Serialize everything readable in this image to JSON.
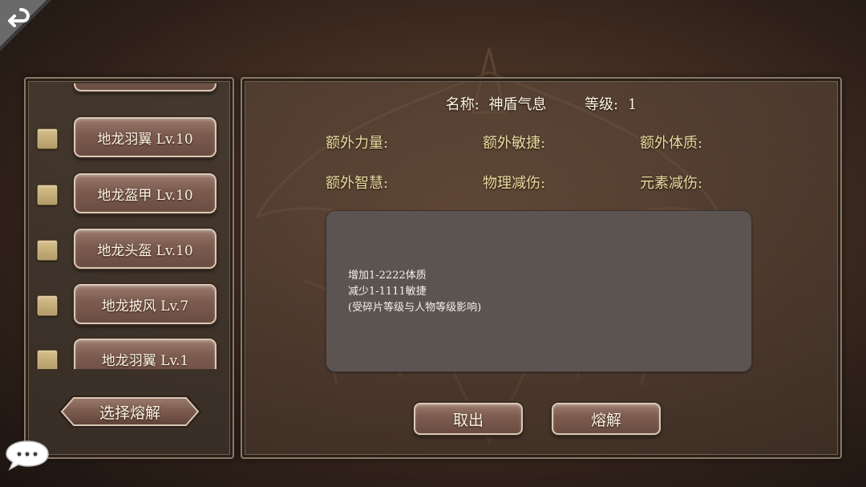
{
  "left_list": {
    "items": [
      {
        "label": ""
      },
      {
        "label": "地龙羽翼 Lv.10"
      },
      {
        "label": "地龙盔甲 Lv.10"
      },
      {
        "label": "地龙头盔 Lv.10"
      },
      {
        "label": "地龙披风 Lv.7"
      },
      {
        "label": "地龙羽翼 Lv.1"
      }
    ],
    "select_label": "选择熔解"
  },
  "detail": {
    "name_label": "名称:",
    "name_value": "神盾气息",
    "level_label": "等级:",
    "level_value": "1",
    "attrs": {
      "extra_strength": "额外力量:",
      "extra_agility": "额外敏捷:",
      "extra_constitution": "额外体质:",
      "extra_wisdom": "额外智慧:",
      "physical_reduction": "物理减伤:",
      "element_reduction": "元素减伤:"
    },
    "description": [
      "增加1-2222体质",
      "减少1-1111敏捷",
      "(受碎片等级与人物等级影响)"
    ]
  },
  "buttons": {
    "cancel": "取出",
    "smelt": "熔解"
  },
  "icons": {
    "back": "back-arrow-icon",
    "chat": "chat-bubble-icon"
  },
  "colors": {
    "accent_text": "#e9dca0",
    "button_fill": "#7d5d50",
    "panel_border": "#8a7a68"
  }
}
